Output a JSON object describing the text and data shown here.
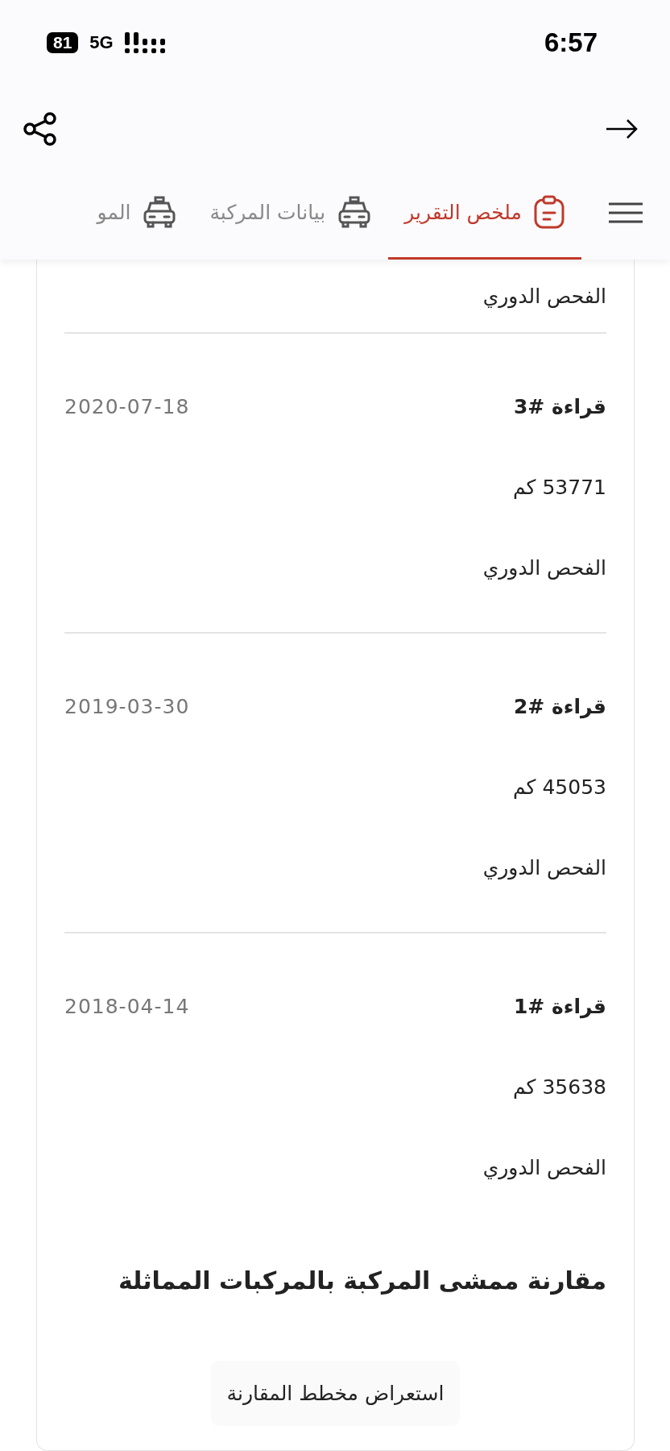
{
  "status_bar": {
    "battery": "81",
    "network": "5G",
    "time": "6:57"
  },
  "tabs": [
    {
      "label": "ملخص التقرير",
      "kind": "report",
      "selected": true
    },
    {
      "label": "بيانات المركبة",
      "kind": "car",
      "selected": false
    },
    {
      "label": "المو",
      "kind": "car",
      "selected": false
    }
  ],
  "previous_entry_tail": "الفحص الدوري",
  "readings": [
    {
      "title": "قراءة #3",
      "date": "2020-07-18",
      "odometer": "53771 كم",
      "type": "الفحص الدوري"
    },
    {
      "title": "قراءة #2",
      "date": "2019-03-30",
      "odometer": "45053 كم",
      "type": "الفحص الدوري"
    },
    {
      "title": "قراءة #1",
      "date": "2018-04-14",
      "odometer": "35638 كم",
      "type": "الفحص الدوري"
    }
  ],
  "comparison": {
    "heading": "مقارنة ممشى المركبة بالمركبات المماثلة",
    "button": "استعراض مخطط المقارنة"
  }
}
